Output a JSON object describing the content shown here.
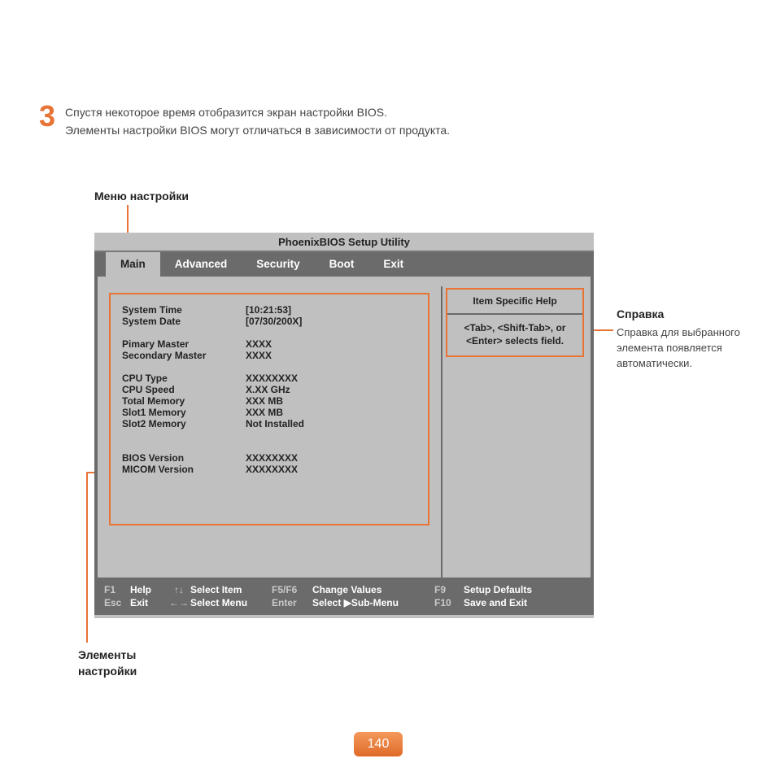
{
  "step": {
    "number": "3",
    "line1": "Спустя некоторое время отобразится экран настройки BIOS.",
    "line2": "Элементы настройки BIOS могут отличаться в зависимости от продукта."
  },
  "labels": {
    "menu": "Меню настройки",
    "items": "Элементы настройки",
    "help_title": "Справка",
    "help_body": "Справка для выбранного элемента появляется автоматически."
  },
  "bios": {
    "title": "PhoenixBIOS Setup Utility",
    "tabs": [
      "Main",
      "Advanced",
      "Security",
      "Boot",
      "Exit"
    ],
    "active_tab": 0,
    "rows": [
      {
        "k": "System Time",
        "v": "[10:21:53]"
      },
      {
        "k": "System Date",
        "v": "[07/30/200X]"
      },
      {
        "gap": true
      },
      {
        "k": "Pimary Master",
        "v": "XXXX"
      },
      {
        "k": "Secondary Master",
        "v": "XXXX"
      },
      {
        "gap": true
      },
      {
        "k": "CPU Type",
        "v": "XXXXXXXX"
      },
      {
        "k": "CPU Speed",
        "v": "X.XX GHz"
      },
      {
        "k": "Total Memory",
        "v": "XXX MB"
      },
      {
        "k": "Slot1 Memory",
        "v": "XXX MB"
      },
      {
        "k": "Slot2 Memory",
        "v": "Not Installed"
      },
      {
        "gap": true
      },
      {
        "gap": true
      },
      {
        "k": "BIOS Version",
        "v": "XXXXXXXX"
      },
      {
        "k": "MICOM Version",
        "v": "XXXXXXXX"
      }
    ],
    "help_panel": {
      "title": "Item Specific Help",
      "body": "<Tab>, <Shift-Tab>, or <Enter> selects field."
    },
    "footer": {
      "f1": "F1",
      "help": "Help",
      "esc": "Esc",
      "exit": "Exit",
      "updown": "↑↓",
      "select_item": "Select Item",
      "leftright": "←→",
      "select_menu": "Select Menu",
      "f5f6": "F5/F6",
      "change_values": "Change Values",
      "enter": "Enter",
      "select_submenu": "Select  ▶Sub-Menu",
      "f9": "F9",
      "setup_defaults": "Setup Defaults",
      "f10": "F10",
      "save_exit": "Save and Exit"
    }
  },
  "page_number": "140"
}
